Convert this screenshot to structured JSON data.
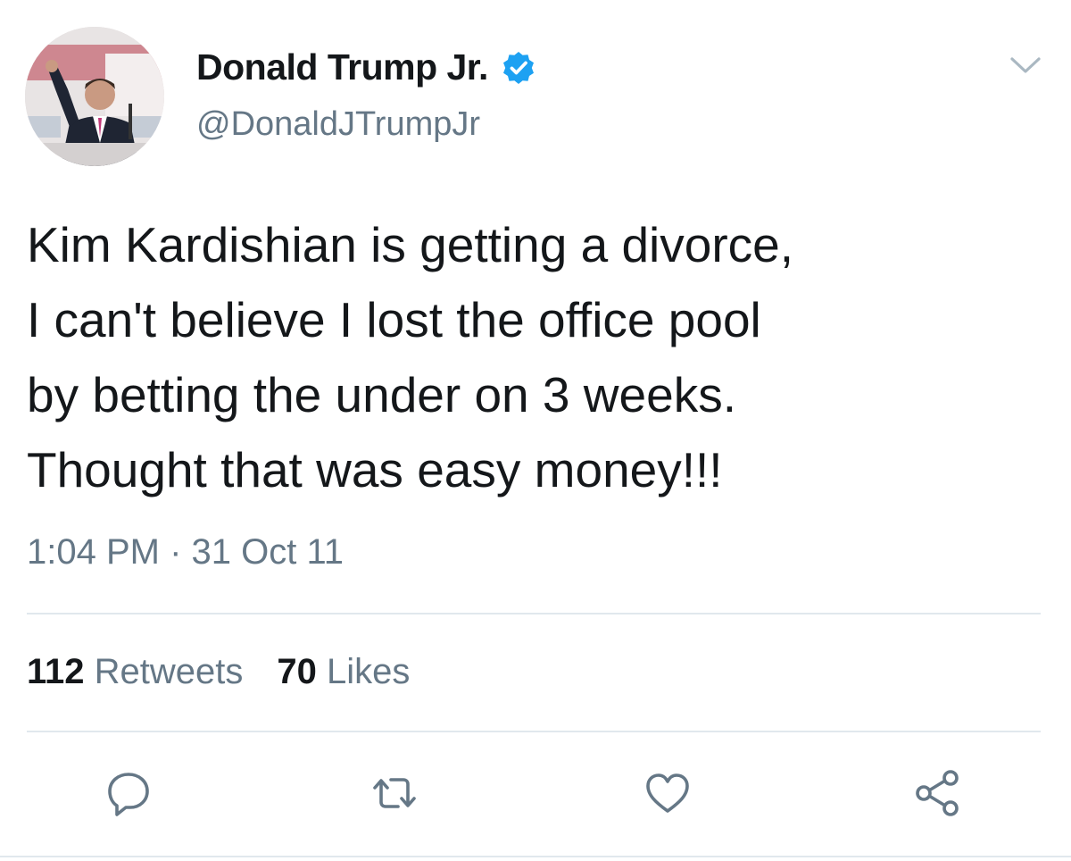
{
  "user": {
    "display_name": "Donald Trump Jr.",
    "handle": "@DonaldJTrumpJr",
    "verified": true,
    "verified_color": "#1da1f2"
  },
  "tweet": {
    "text": "Kim Kardishian is getting a divorce,\nI can't believe I lost the office pool\nby betting the under on 3 weeks.\nThought that was easy money!!!",
    "timestamp": "1:04 PM · 31 Oct 11"
  },
  "stats": {
    "retweets_count": "112",
    "retweets_label": "Retweets",
    "likes_count": "70",
    "likes_label": "Likes"
  },
  "actions": {
    "icons": [
      "reply-icon",
      "retweet-icon",
      "like-icon",
      "share-icon"
    ],
    "icon_color": "#657786"
  },
  "colors": {
    "text": "#14171a",
    "secondary": "#657786",
    "divider": "#e1e8ed"
  }
}
